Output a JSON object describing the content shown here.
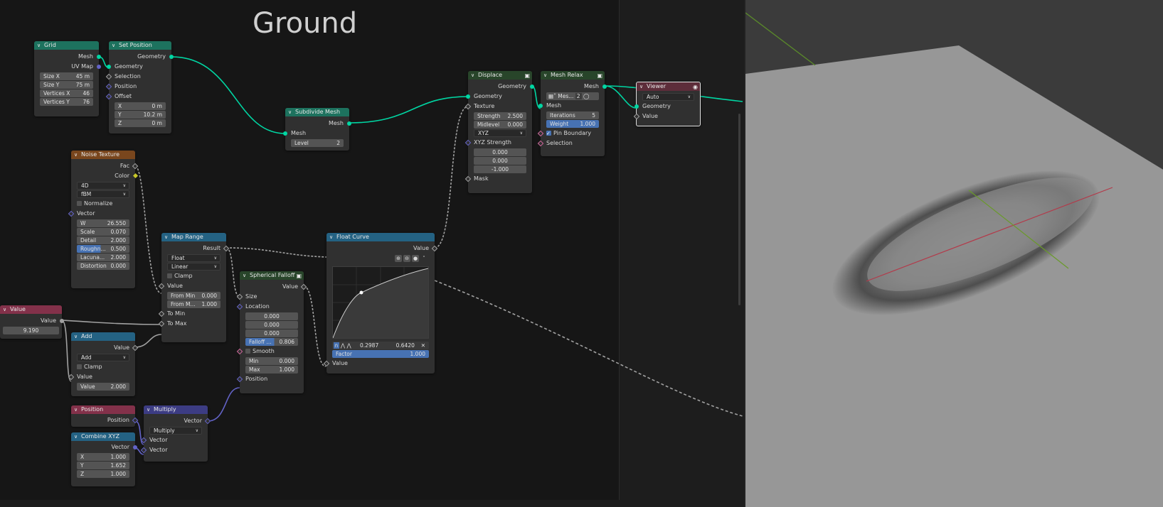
{
  "frame": {
    "title": "Ground"
  },
  "nodes": {
    "grid": {
      "title": "Grid",
      "out_mesh": "Mesh",
      "out_uv": "UV Map",
      "size_x_label": "Size X",
      "size_x": "45 m",
      "size_y_label": "Size Y",
      "size_y": "75 m",
      "vx_label": "Vertices X",
      "vx": "46",
      "vy_label": "Vertices Y",
      "vy": "76"
    },
    "set_position": {
      "title": "Set Position",
      "out_geometry": "Geometry",
      "in_geometry": "Geometry",
      "in_selection": "Selection",
      "in_position": "Position",
      "in_offset": "Offset",
      "x_label": "X",
      "x": "0 m",
      "y_label": "Y",
      "y": "10.2 m",
      "z_label": "Z",
      "z": "0 m"
    },
    "subdivide": {
      "title": "Subdivide Mesh",
      "out_mesh": "Mesh",
      "in_mesh": "Mesh",
      "level_label": "Level",
      "level": "2"
    },
    "displace": {
      "title": "Displace",
      "out_geometry": "Geometry",
      "in_geometry": "Geometry",
      "in_texture": "Texture",
      "strength_label": "Strength",
      "strength": "2.500",
      "midlevel_label": "Midlevel",
      "midlevel": "0.000",
      "mode": "XYZ",
      "xyz_label": "XYZ Strength",
      "v1": "0.000",
      "v2": "0.000",
      "v3": "-1.000",
      "mask": "Mask"
    },
    "mesh_relax": {
      "title": "Mesh Relax",
      "out_mesh": "Mesh",
      "mesh_field": "Mes...",
      "mesh_count": "2",
      "in_mesh": "Mesh",
      "iter_label": "Iterations",
      "iterations": "5",
      "weight_label": "Weight",
      "weight": "1.000",
      "pin_boundary": "Pin Boundary",
      "selection": "Selection"
    },
    "viewer": {
      "title": "Viewer",
      "domain": "Auto",
      "in_geometry": "Geometry",
      "in_value": "Value"
    },
    "noise": {
      "title": "Noise Texture",
      "out_fac": "Fac",
      "out_color": "Color",
      "dim": "4D",
      "type": "fBM",
      "normalize": "Normalize",
      "in_vector": "Vector",
      "w_label": "W",
      "w": "26.550",
      "scale_label": "Scale",
      "scale": "0.070",
      "detail_label": "Detail",
      "detail": "2.000",
      "rough_label": "Roughn...",
      "rough": "0.500",
      "lac_label": "Lacuna...",
      "lac": "2.000",
      "dist_label": "Distortion",
      "dist": "0.000"
    },
    "map_range": {
      "title": "Map Range",
      "out_result": "Result",
      "dtype": "Float",
      "interp": "Linear",
      "clamp": "Clamp",
      "in_value": "Value",
      "from_min_label": "From Min",
      "from_min": "0.000",
      "from_max_label": "From M...",
      "from_max": "1.000",
      "to_min": "To Min",
      "to_max": "To Max"
    },
    "float_curve": {
      "title": "Float Curve",
      "out_value": "Value",
      "px": "0.2987",
      "py": "0.6420",
      "factor_label": "Factor",
      "factor": "1.000",
      "in_value": "Value"
    },
    "spherical": {
      "title": "Spherical Falloff",
      "out_value": "Value",
      "size": "Size",
      "location": "Location",
      "l1": "0.000",
      "l2": "0.000",
      "l3": "0.000",
      "falloff_label": "Falloff ...",
      "falloff": "0.806",
      "smooth": "Smooth",
      "min_label": "Min",
      "min": "0.000",
      "max_label": "Max",
      "max": "1.000",
      "position": "Position"
    },
    "value": {
      "title": "Value",
      "out_value": "Value",
      "value": "9.190"
    },
    "add": {
      "title": "Add",
      "out_value": "Value",
      "op": "Add",
      "clamp": "Clamp",
      "in_value": "Value",
      "val_label": "Value",
      "val": "2.000"
    },
    "position": {
      "title": "Position",
      "out_position": "Position"
    },
    "multiply": {
      "title": "Multiply",
      "out_vector": "Vector",
      "op": "Multiply",
      "in1": "Vector",
      "in2": "Vector"
    },
    "combine": {
      "title": "Combine XYZ",
      "out_vector": "Vector",
      "x_label": "X",
      "x": "1.000",
      "y_label": "Y",
      "y": "1.652",
      "z_label": "Z",
      "z": "1.000"
    }
  },
  "colors": {
    "geometry_socket": "#00d6a3",
    "float_socket": "#a1a1a1",
    "vector_socket": "#6363c7",
    "color_socket": "#c7c729",
    "accent": "#4772b3"
  }
}
